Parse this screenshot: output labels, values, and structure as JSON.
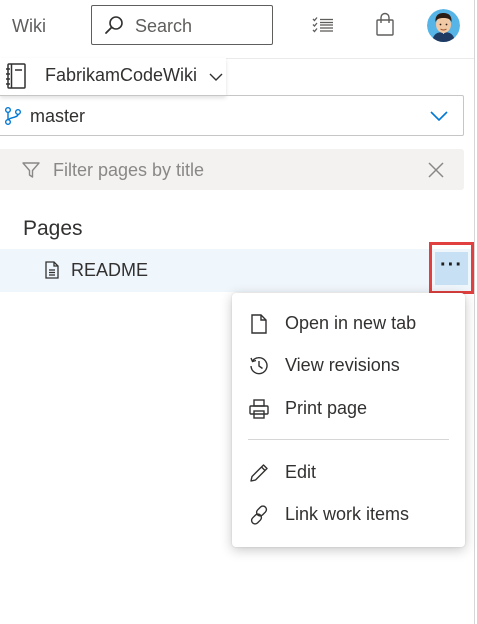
{
  "topbar": {
    "app_label": "Wiki",
    "search_placeholder": "Search",
    "icons": [
      "search-icon",
      "task-list-icon",
      "shopping-bag-icon",
      "user-avatar"
    ]
  },
  "wiki": {
    "name": "FabrikamCodeWiki"
  },
  "branch": {
    "name": "master"
  },
  "filter": {
    "placeholder": "Filter pages by title"
  },
  "pages": {
    "heading": "Pages",
    "items": [
      {
        "label": "README",
        "icon": "document-icon"
      }
    ]
  },
  "more_button": {
    "label": "···"
  },
  "context_menu": {
    "items": [
      {
        "label": "Open in new tab",
        "icon": "new-page-icon"
      },
      {
        "label": "View revisions",
        "icon": "history-icon"
      },
      {
        "label": "Print page",
        "icon": "printer-icon"
      },
      {
        "label": "Edit",
        "icon": "pencil-icon"
      },
      {
        "label": "Link work items",
        "icon": "link-icon"
      }
    ]
  },
  "colors": {
    "selected_row": "#eff6fc",
    "highlight_box": "#e0403f",
    "more_button_bg": "#c7e0f4",
    "accent": "#0078d4"
  }
}
